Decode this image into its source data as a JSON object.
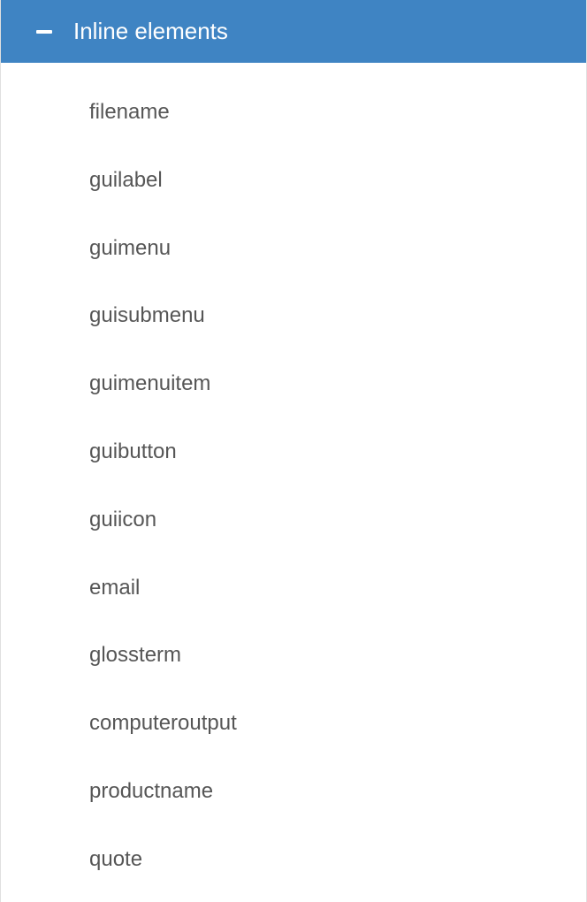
{
  "panel": {
    "title": "Inline elements",
    "items": [
      "filename",
      "guilabel",
      "guimenu",
      "guisubmenu",
      "guimenuitem",
      "guibutton",
      "guiicon",
      "email",
      "glossterm",
      "computeroutput",
      "productname",
      "quote"
    ]
  }
}
